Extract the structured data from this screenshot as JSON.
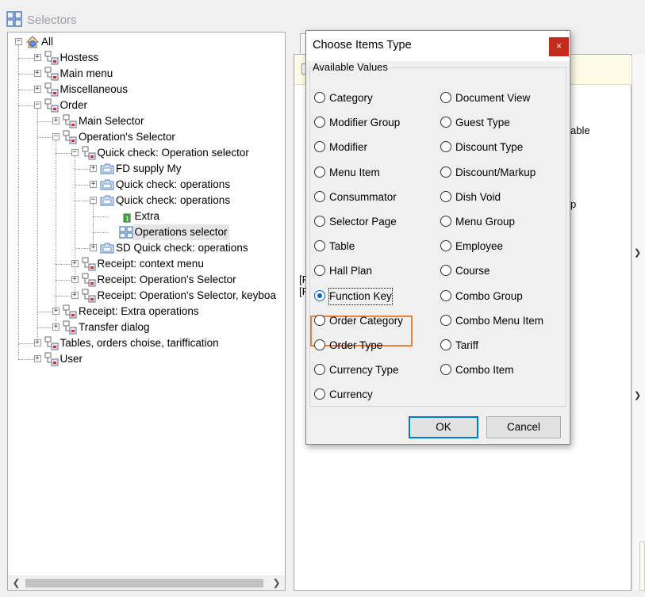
{
  "window": {
    "title": "Selectors"
  },
  "tree": {
    "nodes": [
      {
        "label": "All",
        "icon": "house-globe-icon"
      },
      {
        "label": "Hostess",
        "icon": "selector-group-icon"
      },
      {
        "label": "Main menu",
        "icon": "selector-group-icon"
      },
      {
        "label": "Miscellaneous",
        "icon": "selector-group-icon"
      },
      {
        "label": "Order",
        "icon": "selector-group-icon"
      },
      {
        "label": "Main Selector",
        "icon": "selector-group-icon"
      },
      {
        "label": "Operation's Selector",
        "icon": "selector-group-icon"
      },
      {
        "label": "Quick check: Operation selector",
        "icon": "selector-group-icon"
      },
      {
        "label": "FD supply My",
        "icon": "folder-icon"
      },
      {
        "label": "Quick check: operations",
        "icon": "folder-icon"
      },
      {
        "label": "Quick check: operations",
        "icon": "folder-icon"
      },
      {
        "label": "Extra",
        "icon": "item-icon"
      },
      {
        "label": "Operations selector",
        "icon": "grid-icon"
      },
      {
        "label": "SD Quick check: operations",
        "icon": "folder-icon"
      },
      {
        "label": "Receipt: context menu",
        "icon": "selector-group-icon"
      },
      {
        "label": "Receipt: Operation's Selector",
        "icon": "selector-group-icon"
      },
      {
        "label": "Receipt: Operation's Selector, keyboa",
        "icon": "selector-group-icon"
      },
      {
        "label": "Receipt: Extra operations",
        "icon": "selector-group-icon"
      },
      {
        "label": "Transfer dialog",
        "icon": "selector-group-icon"
      },
      {
        "label": "Tables, orders choise, tariffication",
        "icon": "selector-group-icon"
      },
      {
        "label": "User",
        "icon": "selector-group-icon"
      }
    ]
  },
  "background_fragments": {
    "able": "able",
    "p": "p",
    "bracket1": "[F",
    "bracket2": "[F"
  },
  "dialog": {
    "title": "Choose Items Type",
    "close_label": "×",
    "group_label": "Available Values",
    "left_options": [
      "Category",
      "Modifier Group",
      "Modifier",
      "Menu Item",
      "Consummator",
      "Selector Page",
      "Table",
      "Hall Plan",
      "Function Key",
      "Order Category",
      "Order Type",
      "Currency Type",
      "Currency"
    ],
    "right_options": [
      "Document View",
      "Guest Type",
      "Discount Type",
      "Discount/Markup",
      "Dish Void",
      "Menu Group",
      "Employee",
      "Course",
      "Combo Group",
      "Combo Menu Item",
      "Tariff",
      "Combo Item"
    ],
    "selected": "Function Key",
    "ok_label": "OK",
    "cancel_label": "Cancel",
    "highlight_color": "#f07d38"
  },
  "colors": {
    "accent": "#0078d7",
    "close_button": "#c42b1c"
  }
}
